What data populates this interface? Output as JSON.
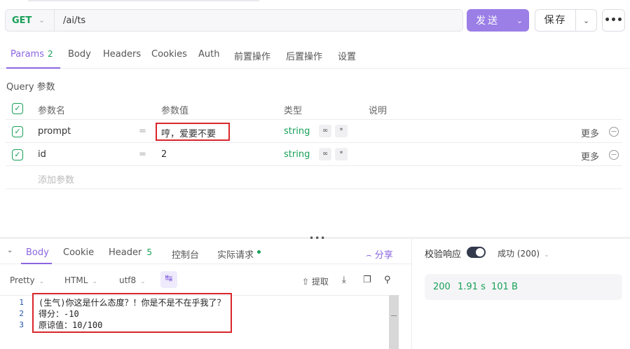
{
  "request": {
    "method": "GET",
    "url": "/ai/ts",
    "send_label": "发送",
    "save_label": "保存",
    "more_label": "•••"
  },
  "tabs": [
    {
      "label": "Params",
      "count": "2"
    },
    {
      "label": "Body"
    },
    {
      "label": "Headers"
    },
    {
      "label": "Cookies"
    },
    {
      "label": "Auth"
    },
    {
      "label": "前置操作"
    },
    {
      "label": "后置操作"
    },
    {
      "label": "设置"
    }
  ],
  "params": {
    "section_title": "Query 参数",
    "columns": [
      "参数名",
      "参数值",
      "类型",
      "说明"
    ],
    "rows": [
      {
        "name": "prompt",
        "value": "哼，爱要不要",
        "type": "string",
        "more": "更多"
      },
      {
        "name": "id",
        "value": "2",
        "type": "string",
        "more": "更多"
      }
    ],
    "add_placeholder": "添加参数"
  },
  "response": {
    "tabs": [
      {
        "label": "Body"
      },
      {
        "label": "Cookie"
      },
      {
        "label": "Header",
        "count": "5"
      },
      {
        "label": "控制台"
      },
      {
        "label": "实际请求"
      }
    ],
    "share_label": "分享",
    "format": "Pretty",
    "lang": "HTML",
    "encoding": "utf8",
    "extract_label": "提取",
    "lines": [
      {
        "num": "1",
        "text": "(生气)你这是什么态度？！你是不是不在乎我了？"
      },
      {
        "num": "2",
        "text": "得分：-10"
      },
      {
        "num": "3",
        "text": "原谅值：10/100"
      }
    ],
    "validate_label": "校验响应",
    "success_label": "成功 (200)",
    "status": "200",
    "time": "1.91 s",
    "size": "101 B"
  }
}
